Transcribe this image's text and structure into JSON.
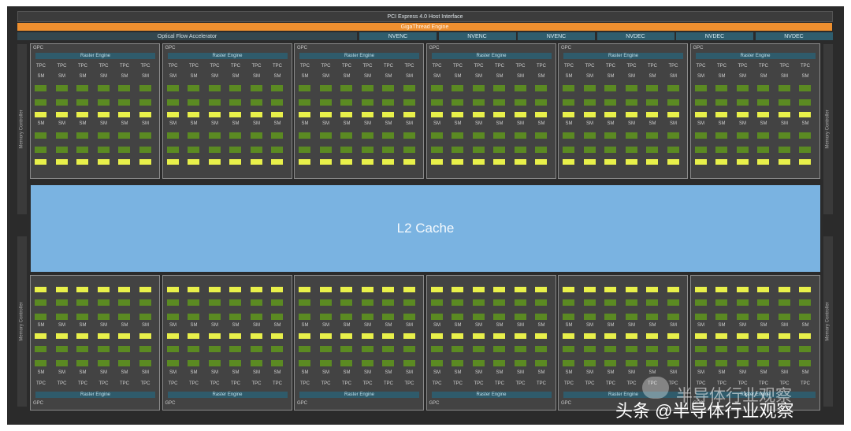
{
  "top": {
    "pcie": "PCI Express 4.0 Host Interface",
    "gigathread": "GigaThread Engine",
    "optical_flow": "Optical Flow Accelerator",
    "media_engines": [
      "NVENC",
      "NVENC",
      "NVENC",
      "NVDEC",
      "NVDEC",
      "NVDEC"
    ]
  },
  "memory_controller_label": "Memory Controller",
  "gpc": {
    "name": "GPC",
    "raster_engine": "Raster Engine",
    "tpc_label": "TPC",
    "sm_label": "SM",
    "count_top_row": 6,
    "count_bottom_row": 6,
    "tpcs_per_gpc": 6
  },
  "l2_cache": "L2 Cache",
  "watermark": {
    "line1": "半导体行业观察",
    "line2": "头条 @半导体行业观察"
  },
  "colors": {
    "background": "#2b2b2b",
    "gigathread": "#ee8f2f",
    "media_engine": "#2f5d6d",
    "l2_cache": "#7ab3e1",
    "sm_block": "#5b8a22",
    "rt_core": "#e8f04a"
  }
}
